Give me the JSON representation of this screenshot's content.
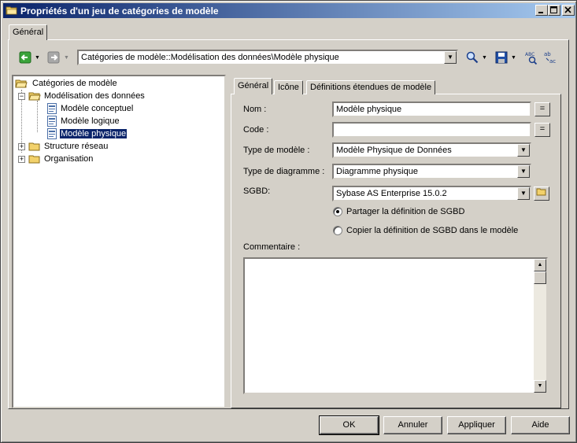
{
  "window": {
    "title": "Propriétés d'un jeu de catégories de modèle",
    "controls": {
      "minimize": "_",
      "maximize": "□",
      "close": "×"
    }
  },
  "outer_tab": "Général",
  "toolbar": {
    "path": "Catégories de modèle::Modélisation des données\\Modèle physique"
  },
  "tree": {
    "root": "Catégories de modèle",
    "items": [
      {
        "label": "Modélisation des données",
        "expander": "−"
      },
      {
        "label": "Modèle conceptuel"
      },
      {
        "label": "Modèle logique"
      },
      {
        "label": "Modèle physique"
      },
      {
        "label": "Structure réseau",
        "expander": "+"
      },
      {
        "label": "Organisation",
        "expander": "+"
      }
    ]
  },
  "inner_tabs": [
    "Général",
    "Icône",
    "Définitions étendues de modèle"
  ],
  "form": {
    "nom": {
      "label": "Nom :",
      "value": "Modèle physique",
      "button": "="
    },
    "code": {
      "label": "Code :",
      "value": "",
      "button": "="
    },
    "type_modele": {
      "label": "Type de modèle :",
      "value": "Modèle Physique de Données"
    },
    "type_diagramme": {
      "label": "Type de diagramme :",
      "value": "Diagramme physique"
    },
    "sgbd": {
      "label": "SGBD:",
      "value": "Sybase AS Enterprise 15.0.2"
    },
    "radio_share": "Partager la définition de SGBD",
    "radio_copy": "Copier la définition de SGBD dans le modèle",
    "selected_radio": "share",
    "commentaire": {
      "label": "Commentaire :",
      "value": ""
    }
  },
  "buttons": {
    "ok": "OK",
    "cancel": "Annuler",
    "apply": "Appliquer",
    "help": "Aide"
  },
  "colors": {
    "titlebar": "#0a246a",
    "face": "#d4d0c8",
    "selection": "#0a246a"
  }
}
